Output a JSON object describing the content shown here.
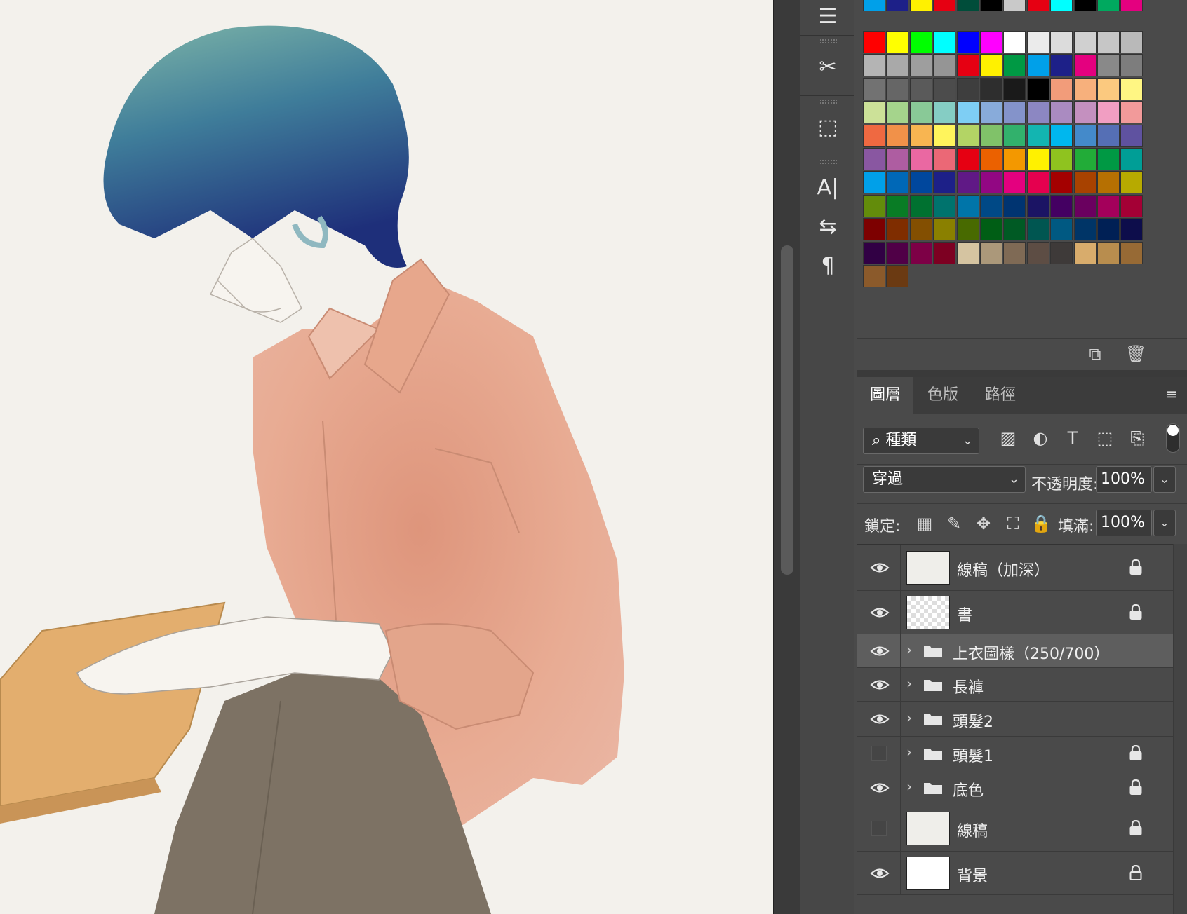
{
  "panels": {
    "tabs": [
      {
        "label": "圖層",
        "active": true
      },
      {
        "label": "色版",
        "active": false
      },
      {
        "label": "路徑",
        "active": false
      }
    ],
    "filter": {
      "label": "種類"
    },
    "blend_mode": "穿過",
    "opacity_label": "不透明度:",
    "opacity_value": "100%",
    "lock_label": "鎖定:",
    "fill_label": "填滿:",
    "fill_value": "100%"
  },
  "layers": [
    {
      "name": "線稿（加深）",
      "type": "pixel",
      "visible": true,
      "locked": true,
      "selected": false,
      "thumb": "sketch"
    },
    {
      "name": "書",
      "type": "pixel",
      "visible": true,
      "locked": true,
      "selected": false,
      "thumb": "transparent"
    },
    {
      "name": "上衣圖樣（250/700）",
      "type": "group",
      "visible": true,
      "locked": false,
      "selected": true
    },
    {
      "name": "長褲",
      "type": "group",
      "visible": true,
      "locked": false,
      "selected": false
    },
    {
      "name": "頭髮2",
      "type": "group",
      "visible": true,
      "locked": false,
      "selected": false
    },
    {
      "name": "頭髮1",
      "type": "group",
      "visible": false,
      "locked": true,
      "selected": false
    },
    {
      "name": "底色",
      "type": "group",
      "visible": true,
      "locked": true,
      "selected": false
    },
    {
      "name": "線稿",
      "type": "pixel",
      "visible": false,
      "locked": true,
      "selected": false,
      "thumb": "sketch"
    },
    {
      "name": "背景",
      "type": "pixel",
      "visible": true,
      "locked": true,
      "selected": false,
      "thumb": "white"
    }
  ],
  "swatches": {
    "top_row": [
      "#00a0e9",
      "#1d2088",
      "#fff100",
      "#e60012",
      "#004d3a",
      "#000000",
      "#c9c9c9",
      "#e60012",
      "#00ffff",
      "#000000",
      "#00a95f",
      "#e4007f"
    ],
    "grid": [
      "#ff0000",
      "#ffff00",
      "#00ff00",
      "#00ffff",
      "#0000ff",
      "#ff00ff",
      "#ffffff",
      "#ebebeb",
      "#dcdcdc",
      "#d0d0d0",
      "#c6c6c6",
      "#b9b9b9",
      "#b4b4b4",
      "#a9a9a9",
      "#9e9e9e",
      "#959595",
      "#e60012",
      "#fff100",
      "#009944",
      "#00a0e9",
      "#1d2088",
      "#e4007f",
      "#898989",
      "#7d7d7d",
      "#727272",
      "#666666",
      "#5a5a5a",
      "#4c4c4c",
      "#3e3e3e",
      "#2e2e2e",
      "#1a1a1a",
      "#000000",
      "#f29c7a",
      "#f7b07c",
      "#fbc97f",
      "#fff683",
      "#cce198",
      "#a5d48c",
      "#89c997",
      "#85cdc4",
      "#7ecef4",
      "#88abda",
      "#8493ca",
      "#8c87c2",
      "#aa8bc1",
      "#c490bf",
      "#f19ec2",
      "#f29a9a",
      "#ef6941",
      "#f19149",
      "#f8b551",
      "#fff45c",
      "#b3d465",
      "#80c269",
      "#32b16c",
      "#13b5b1",
      "#00b7ee",
      "#448aca",
      "#556fb5",
      "#5f52a0",
      "#8957a1",
      "#ae5da1",
      "#ea68a2",
      "#eb6876",
      "#e60012",
      "#eb6100",
      "#f39800",
      "#fff100",
      "#8fc31f",
      "#22ac38",
      "#009944",
      "#009e96",
      "#00a0e9",
      "#0068b7",
      "#00479d",
      "#1d2088",
      "#601986",
      "#920783",
      "#e4007f",
      "#e5004f",
      "#a40000",
      "#a84200",
      "#b67002",
      "#b7aa00",
      "#638c0b",
      "#097c25",
      "#007130",
      "#00736d",
      "#0075a9",
      "#004986",
      "#003471",
      "#1b1464",
      "#440062",
      "#6a005f",
      "#a4005b",
      "#a40035",
      "#7d0000",
      "#7f2d00",
      "#834f01",
      "#8a8000",
      "#486a00",
      "#005e15",
      "#005a24",
      "#005651",
      "#005982",
      "#003567",
      "#002055",
      "#0d0d4b",
      "#310044",
      "#500047",
      "#7d0046",
      "#7d0022",
      "#d5c4a1",
      "#ab987a",
      "#7f6a55",
      "#5d4d44",
      "#3e3a39",
      "#d8ac6c",
      "#b88d4e",
      "#976a35",
      "#8b5a2b",
      "#6b3a12"
    ]
  }
}
